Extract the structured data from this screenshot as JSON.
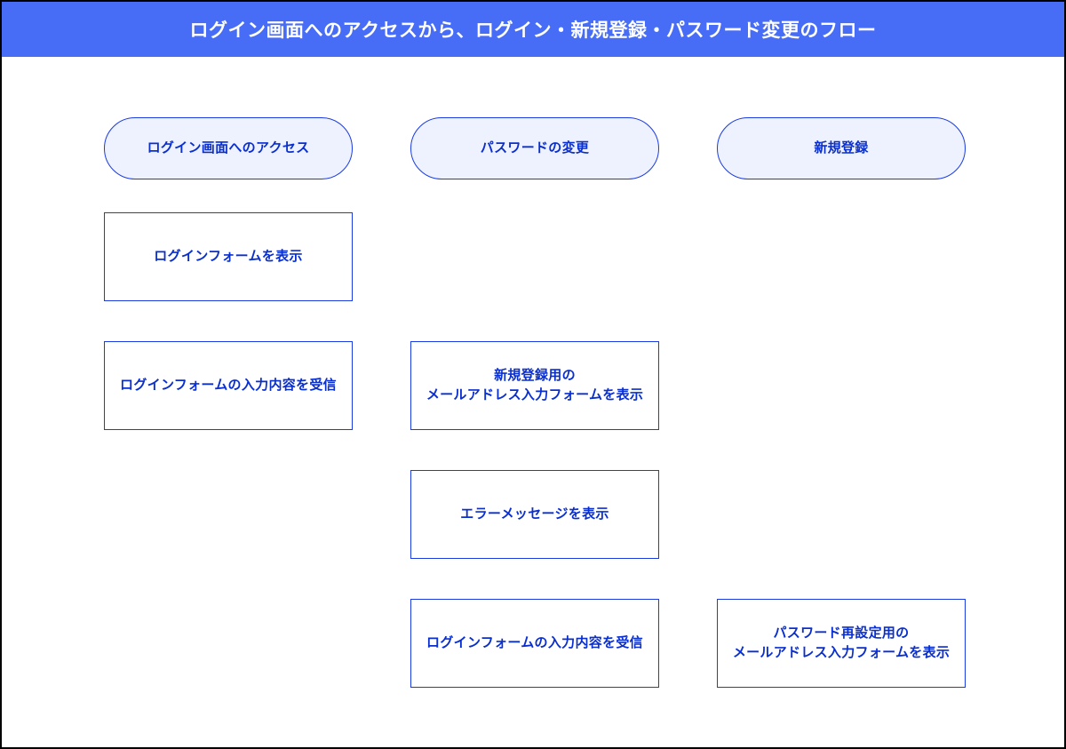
{
  "header": {
    "title": "ログイン画面へのアクセスから、ログイン・新規登録・パスワード変更のフロー"
  },
  "colors": {
    "accent": "#476DF7",
    "text": "#0a2fcf",
    "pillBg": "#eef2ff",
    "border": "#1a3be0"
  },
  "nodes": {
    "top": {
      "loginAccess": "ログイン画面へのアクセス",
      "passwordChange": "パスワードの変更",
      "newRegister": "新規登録"
    },
    "steps": {
      "showLoginForm": "ログインフォームを表示",
      "receiveLoginInput": "ログインフォームの入力内容を受信",
      "showSignupEmailForm": "新規登録用の\nメールアドレス入力フォームを表示",
      "showErrorMessage": "エラーメッセージを表示",
      "receiveLoginInput2": "ログインフォームの入力内容を受信",
      "showPwdResetEmailForm": "パスワード再設定用の\nメールアドレス入力フォームを表示"
    }
  }
}
